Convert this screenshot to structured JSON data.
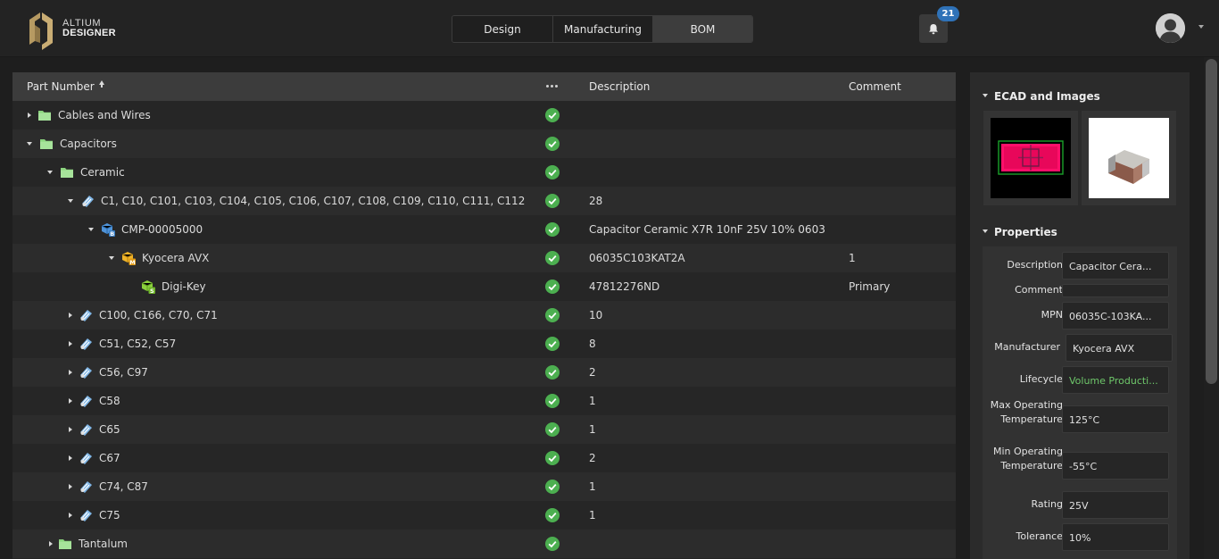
{
  "app": {
    "logo_line1": "ALTIUM",
    "logo_line2": "DESIGNER",
    "tabs": [
      {
        "label": "Design"
      },
      {
        "label": "Manufacturing"
      },
      {
        "label": "BOM"
      }
    ],
    "active_tab": "BOM",
    "notification_count": "21",
    "icons": {
      "notifications": "bell-icon",
      "user": "avatar",
      "menu": "chevron-down-icon"
    }
  },
  "grid": {
    "columns": {
      "part_number": "Part Number",
      "description": "Description",
      "comment": "Comment"
    },
    "sort": "ascending",
    "rows": [
      {
        "label": "Cables and Wires",
        "expanded": false,
        "icon": "folder-icon",
        "status": "ok",
        "description": "",
        "comment": ""
      },
      {
        "label": "Capacitors",
        "expanded": true,
        "icon": "folder-icon",
        "status": "ok",
        "description": "",
        "comment": ""
      },
      {
        "label": "Ceramic",
        "expanded": true,
        "icon": "folder-icon",
        "status": "ok",
        "description": "",
        "comment": ""
      },
      {
        "label": "C1, C10, C101, C103, C104, C105, C106, C107, C108, C109, C110, C111, C112",
        "expanded": true,
        "icon": "designator-icon",
        "status": "ok",
        "description": "28",
        "comment": ""
      },
      {
        "label": "CMP-00005000",
        "expanded": true,
        "icon": "component-icon",
        "status": "ok",
        "description": "Capacitor Ceramic X7R 10nF 25V 10% 0603",
        "comment": ""
      },
      {
        "label": "Kyocera AVX",
        "expanded": true,
        "icon": "manufacturer-icon",
        "status": "ok",
        "description": "06035C103KAT2A",
        "comment": "1"
      },
      {
        "label": "Digi-Key",
        "expanded": null,
        "icon": "supplier-icon",
        "status": "ok",
        "description": "47812276ND",
        "comment": "Primary"
      },
      {
        "label": "C100, C166, C70, C71",
        "expanded": false,
        "icon": "designator-icon",
        "status": "ok",
        "description": "10",
        "comment": ""
      },
      {
        "label": "C51, C52, C57",
        "expanded": false,
        "icon": "designator-icon",
        "status": "ok",
        "description": "8",
        "comment": ""
      },
      {
        "label": "C56, C97",
        "expanded": false,
        "icon": "designator-icon",
        "status": "ok",
        "description": "2",
        "comment": ""
      },
      {
        "label": "C58",
        "expanded": false,
        "icon": "designator-icon",
        "status": "ok",
        "description": "1",
        "comment": ""
      },
      {
        "label": "C65",
        "expanded": false,
        "icon": "designator-icon",
        "status": "ok",
        "description": "1",
        "comment": ""
      },
      {
        "label": "C67",
        "expanded": false,
        "icon": "designator-icon",
        "status": "ok",
        "description": "2",
        "comment": ""
      },
      {
        "label": "C74, C87",
        "expanded": false,
        "icon": "designator-icon",
        "status": "ok",
        "description": "1",
        "comment": ""
      },
      {
        "label": "C75",
        "expanded": false,
        "icon": "designator-icon",
        "status": "ok",
        "description": "1",
        "comment": ""
      },
      {
        "label": "Tantalum",
        "expanded": false,
        "icon": "folder-icon",
        "status": "ok",
        "description": "",
        "comment": ""
      }
    ]
  },
  "panel": {
    "ecad_title": "ECAD and Images",
    "properties_title": "Properties",
    "images": [
      {
        "name": "footprint-image",
        "alt": "PCB footprint"
      },
      {
        "name": "3d-model-image",
        "alt": "Component 3D model"
      }
    ],
    "properties": [
      {
        "label": "Description",
        "value": "Capacitor Cera..."
      },
      {
        "label": "Comment",
        "value": ""
      },
      {
        "label": "MPN",
        "value": "06035C-103KA..."
      },
      {
        "label": "Manufacturer",
        "value": "Kyocera AVX"
      },
      {
        "label": "Lifecycle",
        "value": "Volume Producti..."
      },
      {
        "label": "Max Operating Temperature",
        "value": "125°C"
      },
      {
        "label": "Min Operating Temperature",
        "value": "-55°C"
      },
      {
        "label": "Rating",
        "value": "25V"
      },
      {
        "label": "Tolerance",
        "value": "10%"
      }
    ]
  },
  "colors": {
    "accent_blue": "#2f72b8",
    "status_ok": "#4caf50",
    "lifecycle_green": "#6ec76a",
    "footprint_pad": "#ff0f6a"
  }
}
